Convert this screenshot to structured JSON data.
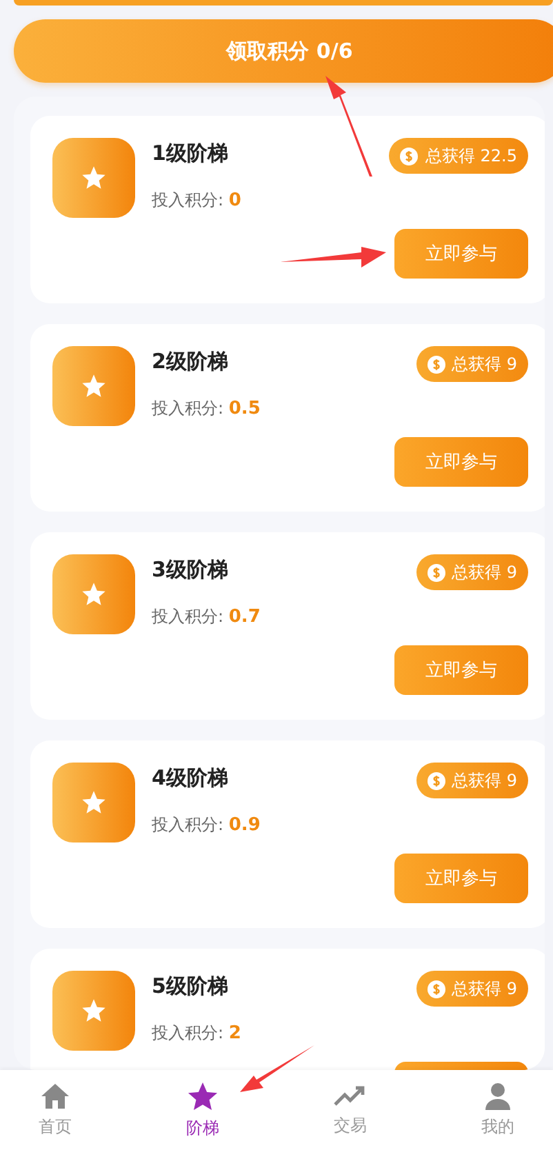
{
  "claim_button": {
    "label": "领取积分 0/6"
  },
  "levels": [
    {
      "title": "1级阶梯",
      "points_label": "投入积分:",
      "points": "0",
      "earned": "总获得 22.5",
      "button": "立即参与"
    },
    {
      "title": "2级阶梯",
      "points_label": "投入积分:",
      "points": "0.5",
      "earned": "总获得 9",
      "button": "立即参与"
    },
    {
      "title": "3级阶梯",
      "points_label": "投入积分:",
      "points": "0.7",
      "earned": "总获得 9",
      "button": "立即参与"
    },
    {
      "title": "4级阶梯",
      "points_label": "投入积分:",
      "points": "0.9",
      "earned": "总获得 9",
      "button": "立即参与"
    },
    {
      "title": "5级阶梯",
      "points_label": "投入积分:",
      "points": "2",
      "earned": "总获得 9"
    }
  ],
  "tab_bar": [
    {
      "kind": "home",
      "label": "首页",
      "selected": false
    },
    {
      "kind": "star",
      "label": "阶梯",
      "selected": true
    },
    {
      "kind": "trend",
      "label": "交易",
      "selected": false
    },
    {
      "kind": "user",
      "label": "我的",
      "selected": false
    }
  ]
}
